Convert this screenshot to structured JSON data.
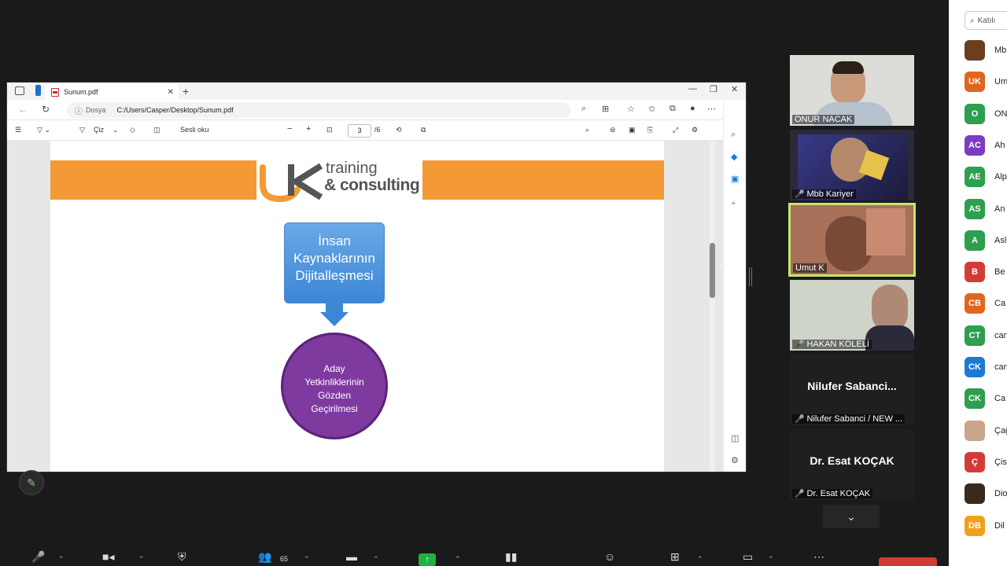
{
  "browser": {
    "tab_title": "Sunum.pdf",
    "url_prefix": "Dosya",
    "url_path": "C:/Users/Casper/Desktop/Sunum.pdf"
  },
  "pdf_toolbar": {
    "draw_label": "Çiz",
    "read_aloud_label": "Sesli oku",
    "zoom_minus": "−",
    "zoom_plus": "+",
    "page_current": "3",
    "page_total": "/6"
  },
  "slide": {
    "logo_line1": "training",
    "logo_line2": "& consulting",
    "box_text_1": "İnsan",
    "box_text_2": "Kaynaklarının",
    "box_text_3": "Dijitalleşmesi",
    "circle_text_1": "Aday",
    "circle_text_2": "Yetkinliklerinin",
    "circle_text_3": "Gözden",
    "circle_text_4": "Geçirilmesi"
  },
  "video_tiles": [
    {
      "name": "ONUR NACAK",
      "muted": false
    },
    {
      "name": "Mbb Kariyer",
      "muted": true
    },
    {
      "name": "Umut K",
      "muted": false,
      "active": true
    },
    {
      "name": "HAKAN KÖLELİ",
      "muted": true
    },
    {
      "name": "Nilufer Sabanci / NEW ...",
      "big": "Nilufer  Sabanci...",
      "muted": true
    },
    {
      "name": "Dr. Esat KOÇAK",
      "big": "Dr. Esat KOÇAK",
      "muted": true
    }
  ],
  "panel": {
    "search_placeholder": "Katılı",
    "participants": [
      {
        "initials": "",
        "name": "Mb",
        "color": "#6b3e1e"
      },
      {
        "initials": "UK",
        "name": "Um",
        "color": "#e0661e"
      },
      {
        "initials": "O",
        "name": "ON",
        "color": "#2e9e4f"
      },
      {
        "initials": "AC",
        "name": "Ah",
        "color": "#7a3cc0"
      },
      {
        "initials": "AE",
        "name": "Alp",
        "color": "#2e9e4f"
      },
      {
        "initials": "AS",
        "name": "An",
        "color": "#2e9e4f"
      },
      {
        "initials": "A",
        "name": "Asl",
        "color": "#2e9e4f"
      },
      {
        "initials": "B",
        "name": "Be",
        "color": "#d33c36"
      },
      {
        "initials": "CB",
        "name": "Ca",
        "color": "#e0661e"
      },
      {
        "initials": "CT",
        "name": "can",
        "color": "#2e9e4f"
      },
      {
        "initials": "CK",
        "name": "can",
        "color": "#1c7ad6"
      },
      {
        "initials": "CK",
        "name": "Ca",
        "color": "#2e9e4f"
      },
      {
        "initials": "",
        "name": "Çağ",
        "color": "#c9a38a"
      },
      {
        "initials": "Ç",
        "name": "Çis",
        "color": "#d33c36"
      },
      {
        "initials": "",
        "name": "Dio",
        "color": "#3a2a1a"
      },
      {
        "initials": "DB",
        "name": "Dil",
        "color": "#f0a020"
      }
    ]
  },
  "toolbar": {
    "participants_count": "65"
  }
}
